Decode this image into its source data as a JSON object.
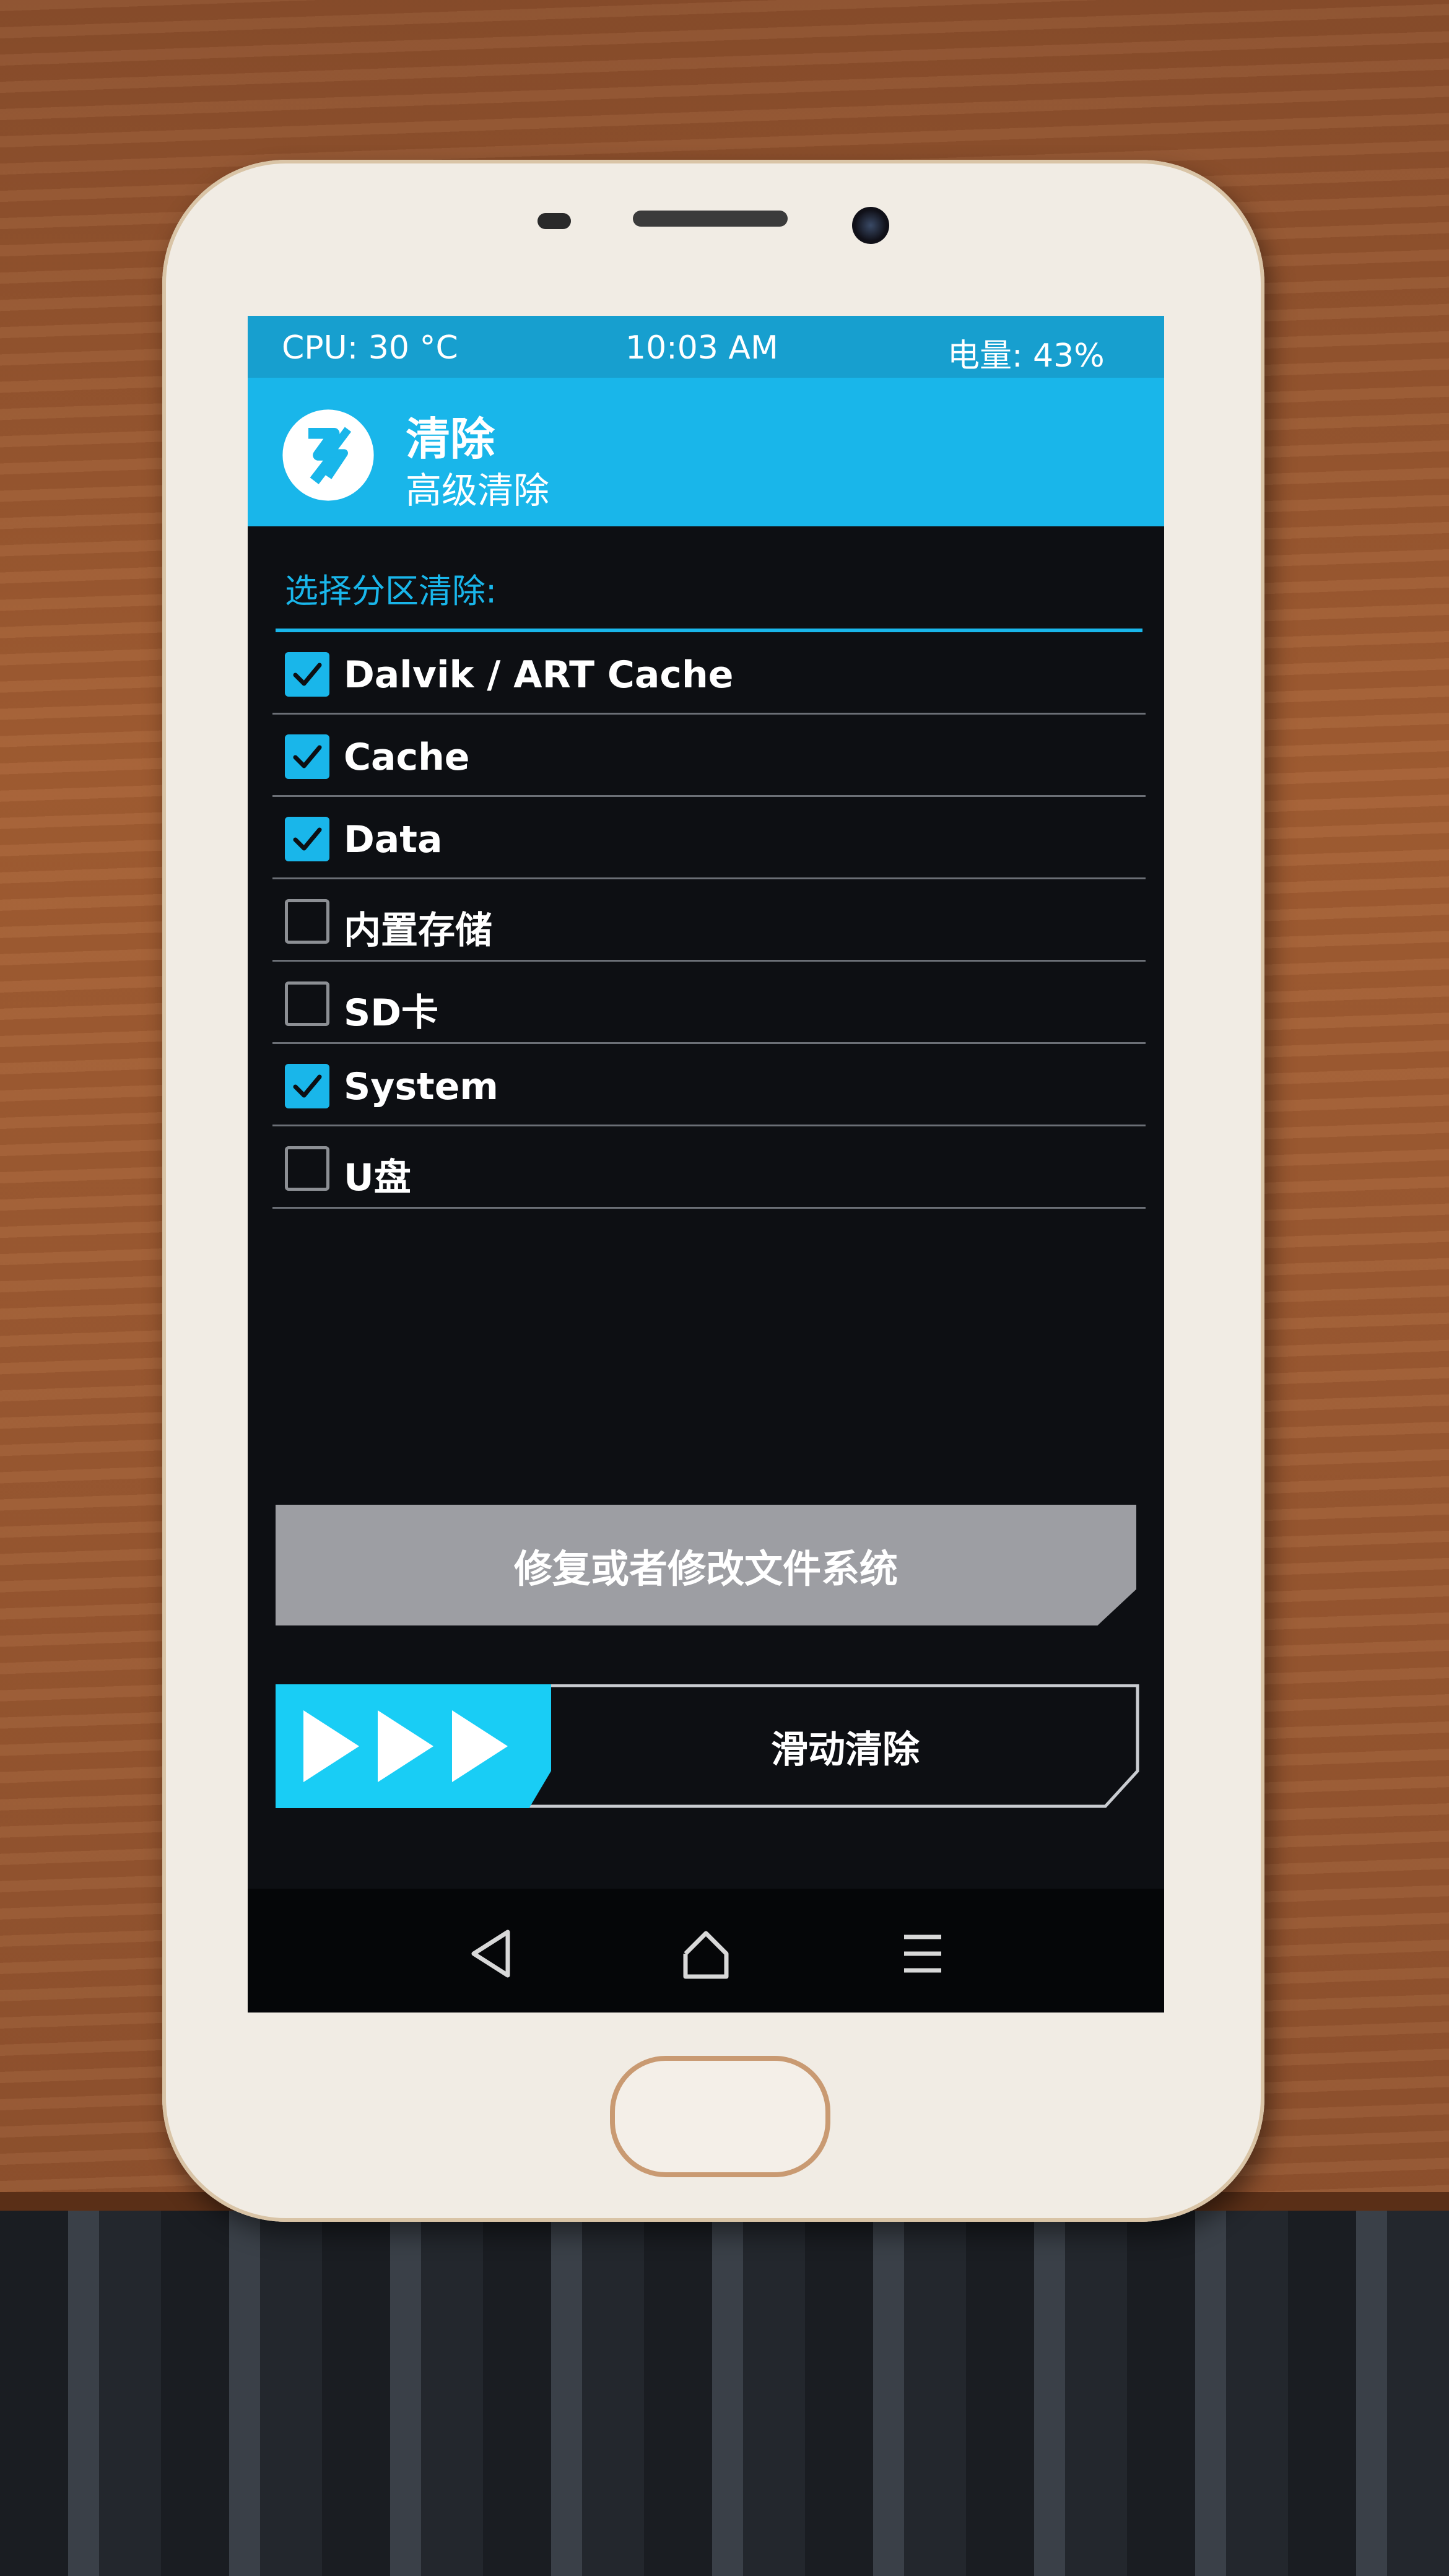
{
  "status_bar": {
    "cpu": "CPU: 30 °C",
    "time": "10:03 AM",
    "battery": "电量: 43%"
  },
  "header": {
    "title": "清除",
    "subtitle": "高级清除"
  },
  "section_label": "选择分区清除:",
  "partitions": [
    {
      "label": "Dalvik / ART Cache",
      "checked": true
    },
    {
      "label": "Cache",
      "checked": true
    },
    {
      "label": "Data",
      "checked": true
    },
    {
      "label": "内置存储",
      "checked": false
    },
    {
      "label": "SD卡",
      "checked": false
    },
    {
      "label": "System",
      "checked": true
    },
    {
      "label": "U盘",
      "checked": false
    }
  ],
  "repair_button": "修复或者修改文件系统",
  "slider": {
    "label": "滑动清除"
  },
  "navbar": {
    "icons": [
      "back-icon",
      "home-icon",
      "menu-icon"
    ]
  },
  "colors": {
    "accent": "#19b6ea",
    "status_bar": "#179fcf",
    "background": "#0d0f13",
    "button": "#9d9ea3"
  }
}
